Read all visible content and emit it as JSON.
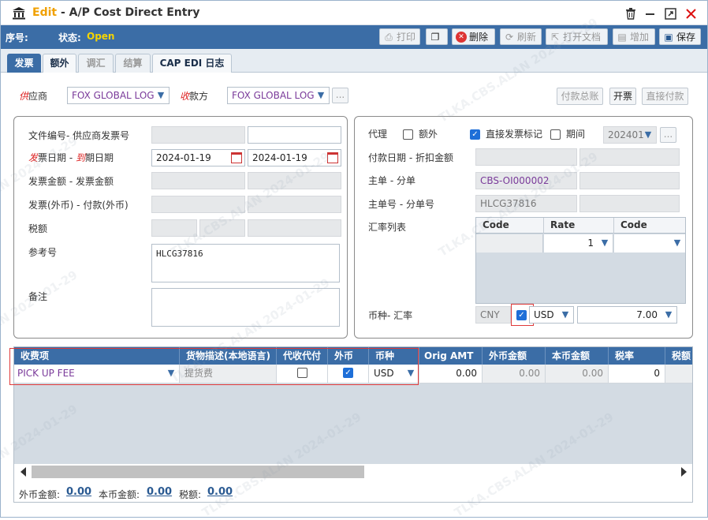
{
  "window": {
    "title_edit": "Edit",
    "title_rest": " - A/P Cost Direct Entry"
  },
  "status": {
    "seq_label": "序号:",
    "state_label": "状态:",
    "state_value": "Open",
    "state_color": "#f5d400"
  },
  "toolbar": {
    "print": "打印",
    "delete": "删除",
    "refresh": "刷新",
    "open_doc": "打开文档",
    "add": "增加",
    "save": "保存"
  },
  "tabs": [
    "发票",
    "额外",
    "调汇",
    "结算",
    "CAP EDI 日志"
  ],
  "header": {
    "vendor_label_red": "供",
    "vendor_label_rest": "应商",
    "vendor_value": "FOX GLOBAL LOG",
    "payee_label_red": "收",
    "payee_label_rest": "款方",
    "payee_value": "FOX GLOBAL LOG",
    "ellipsis": "...",
    "btn_payment_total": "付款总账",
    "btn_invoice": "开票",
    "btn_direct_pay": "直接付款"
  },
  "left_panel": {
    "doc_no_label": "文件编号- 供应商发票号",
    "invoice_date_red1": "发",
    "invoice_date_mid": "票日期 - ",
    "invoice_date_red2": "到",
    "invoice_date_rest": "期日期",
    "invoice_date": "2024-01-19",
    "due_date": "2024-01-19",
    "amount_label": "发票金额 - 发票金额",
    "foreign_label": "发票(外币) - 付款(外币)",
    "tax_label": "税额",
    "ref_label": "参考号",
    "ref_value": "HLCG37816",
    "remark_label": "备注"
  },
  "right_panel": {
    "agent_label": "代理",
    "extra_label": "额外",
    "direct_invoice_label": "直接发票标记",
    "period_label": "期间",
    "period_value": "202401",
    "pay_date_label": "付款日期 - 折扣金额",
    "master_label": "主单 - 分单",
    "master_value": "CBS-OI000002",
    "master_no_label": "主单号 - 分单号",
    "master_no_value": "HLCG37816",
    "rate_list_label": "汇率列表",
    "rate_headers": [
      "Code",
      "Rate",
      "Code"
    ],
    "rate_row": {
      "rate": "1"
    },
    "currency_label": "币种- 汇率",
    "currency_base": "CNY",
    "currency_foreign": "USD",
    "exchange_rate": "7.00"
  },
  "grid": {
    "headers": [
      "收费项",
      "货物描述(本地语言)",
      "代收代付",
      "外币",
      "币种",
      "Orig AMT",
      "外币金额",
      "本币金额",
      "税率",
      "税额"
    ],
    "rows": [
      {
        "charge": "PICK UP FEE",
        "desc": "提货费",
        "currency": "USD",
        "orig_amt": "0.00",
        "foreign_amt": "0.00",
        "local_amt": "0.00",
        "tax_rate": "0"
      }
    ]
  },
  "footer": {
    "foreign_label": "外币金额:",
    "foreign_value": "0.00",
    "local_label": "本币金额:",
    "local_value": "0.00",
    "tax_label": "税额:",
    "tax_value": "0.00"
  },
  "watermark": "TLKA.CBS.ALAN 2024-01-29",
  "colors": {
    "accent": "#3b6da6",
    "edit_title": "#f0a000",
    "purple_text": "#7a3a9a",
    "highlight_border": "#e03a3a"
  }
}
